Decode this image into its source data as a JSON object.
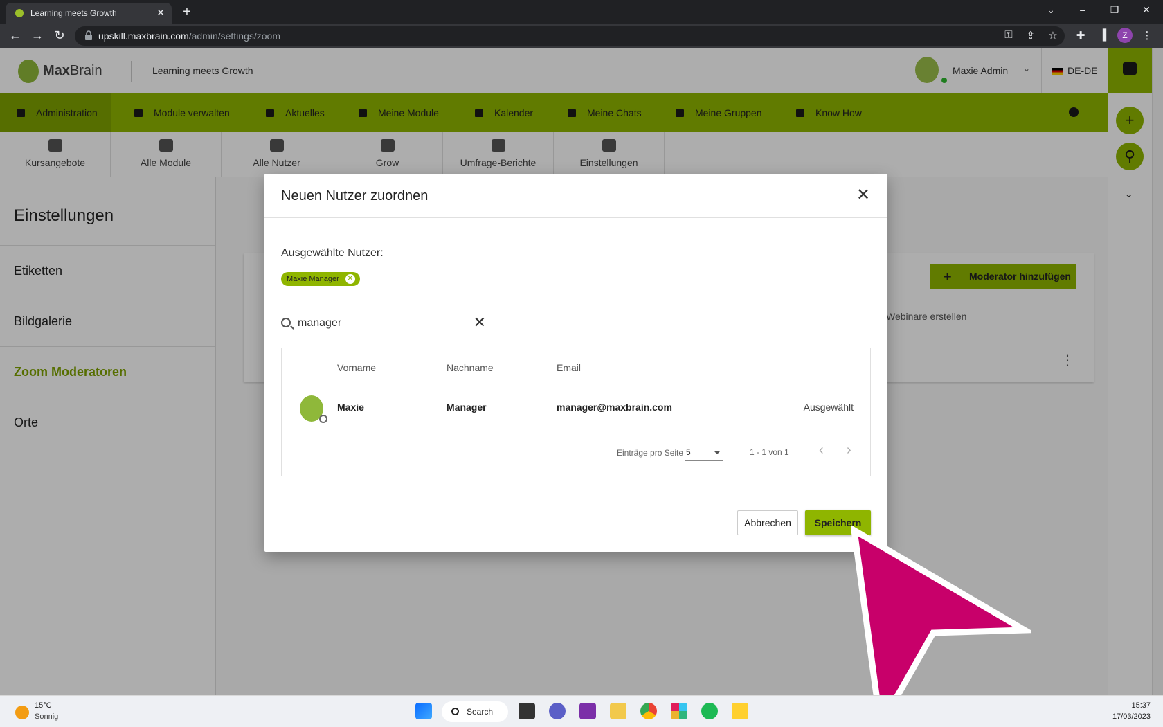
{
  "browser": {
    "tab_title": "Learning meets Growth",
    "url_host": "upskill.maxbrain.com",
    "url_path": "/admin/settings/zoom",
    "profile_initial": "Z"
  },
  "header": {
    "brand_bold": "Max",
    "brand_rest": "Brain",
    "tagline": "Learning meets Growth",
    "user_name": "Maxie Admin",
    "language": "DE-DE"
  },
  "main_menu": [
    {
      "label": "Administration",
      "active": true
    },
    {
      "label": "Module verwalten"
    },
    {
      "label": "Aktuelles"
    },
    {
      "label": "Meine Module"
    },
    {
      "label": "Kalender"
    },
    {
      "label": "Meine Chats"
    },
    {
      "label": "Meine Gruppen"
    },
    {
      "label": "Know How"
    }
  ],
  "sub_menu": [
    {
      "label": "Kursangebote"
    },
    {
      "label": "Alle Module"
    },
    {
      "label": "Alle Nutzer"
    },
    {
      "label": "Grow"
    },
    {
      "label": "Umfrage-Berichte"
    },
    {
      "label": "Einstellungen"
    }
  ],
  "sidebar": {
    "title": "Einstellungen",
    "items": [
      {
        "label": "Etiketten"
      },
      {
        "label": "Bildgalerie"
      },
      {
        "label": "Zoom Moderatoren",
        "active": true
      },
      {
        "label": "Orte"
      }
    ]
  },
  "background": {
    "add_moderator_label": "Moderator hinzufügen",
    "partial_column": "Webinare erstellen"
  },
  "dialog": {
    "title": "Neuen Nutzer zuordnen",
    "selected_label": "Ausgewählte Nutzer:",
    "chip": "Maxie Manager",
    "search_value": "manager",
    "columns": {
      "first": "Vorname",
      "last": "Nachname",
      "email": "Email"
    },
    "row": {
      "first": "Maxie",
      "last": "Manager",
      "email": "manager@maxbrain.com",
      "status": "Ausgewählt"
    },
    "pager": {
      "label": "Einträge pro Seite",
      "page_size": "5",
      "range": "1 - 1 von 1"
    },
    "cancel_label": "Abbrechen",
    "save_label": "Speichern"
  },
  "taskbar": {
    "temperature": "15°C",
    "weather": "Sonnig",
    "search_label": "Search",
    "time": "15:37",
    "date": "17/03/2023"
  },
  "colors": {
    "brand_green": "#8fb500",
    "pointer_magenta": "#c8006a"
  }
}
